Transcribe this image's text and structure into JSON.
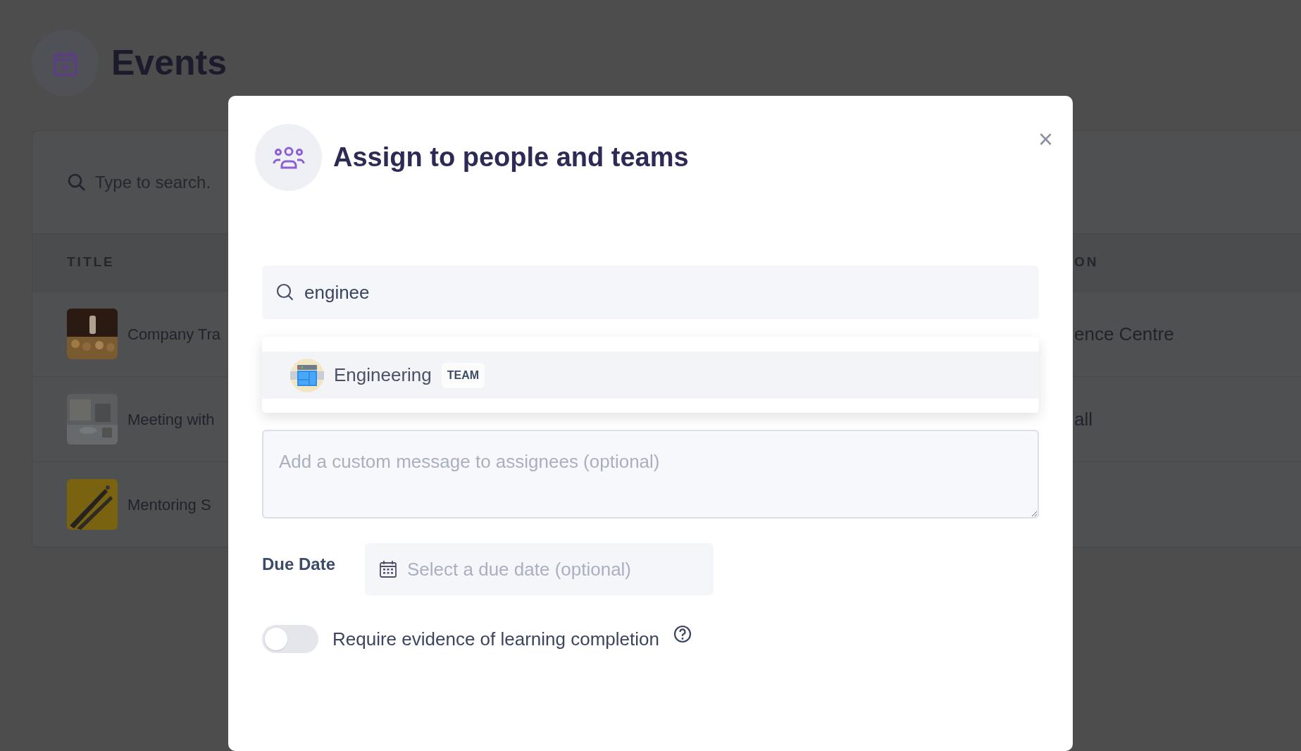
{
  "page": {
    "title": "Events"
  },
  "events_table": {
    "search": {
      "placeholder": "Type to search."
    },
    "columns": [
      "TITLE",
      "ON"
    ],
    "rows": [
      {
        "title": "Company Tra",
        "column_2": "ence Centre"
      },
      {
        "title": "Meeting with",
        "column_2": "all"
      },
      {
        "title": "Mentoring S"
      }
    ]
  },
  "modal": {
    "title": "Assign to people and teams",
    "close": "×",
    "search": {
      "value": "enginee"
    },
    "results": [
      {
        "name": "Engineering",
        "badge": "TEAM",
        "selected": true
      }
    ],
    "message": {
      "placeholder": "Add a custom message to assignees (optional)"
    },
    "due_date": {
      "label": "Due Date",
      "placeholder": "Select a due date (optional)"
    },
    "evidence": {
      "label": "Require evidence of learning completion",
      "on": false
    }
  }
}
